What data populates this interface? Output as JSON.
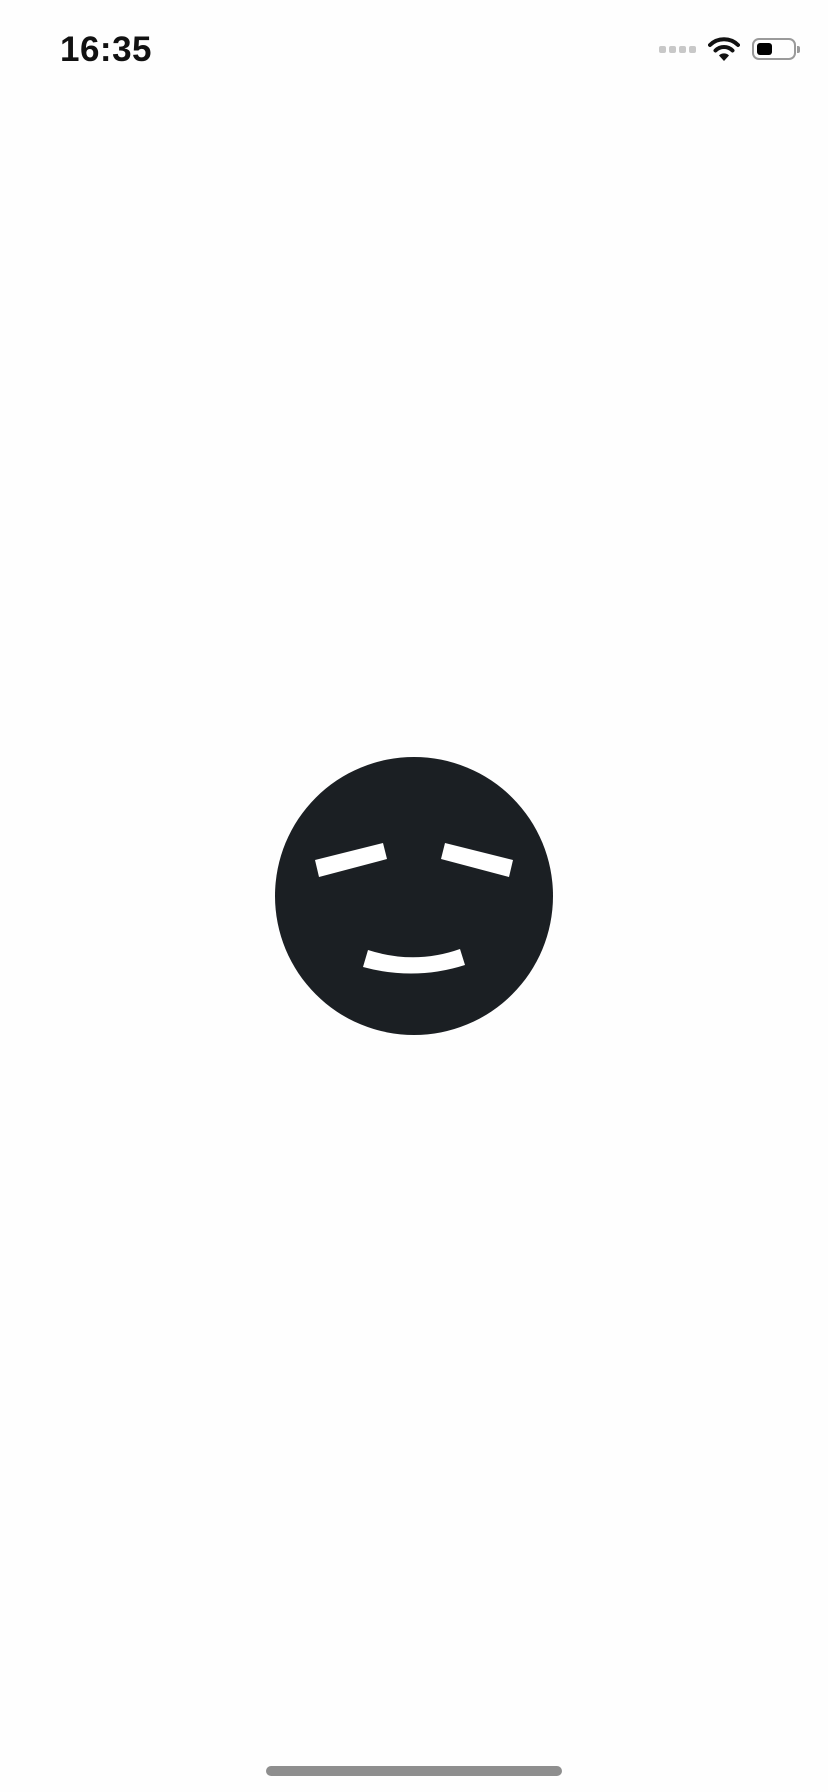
{
  "status_bar": {
    "time": "16:35",
    "signal_icon": "cellular-signal-icon",
    "wifi_icon": "wifi-icon",
    "battery_icon": "battery-icon",
    "battery_level": 0.45
  },
  "main": {
    "face_icon": "sleepy-face-icon"
  },
  "colors": {
    "background": "#fefefe",
    "face": "#1b1f23",
    "face_features": "#ffffff",
    "home_indicator": "#8e8e8e",
    "battery_fill": "#000000"
  }
}
